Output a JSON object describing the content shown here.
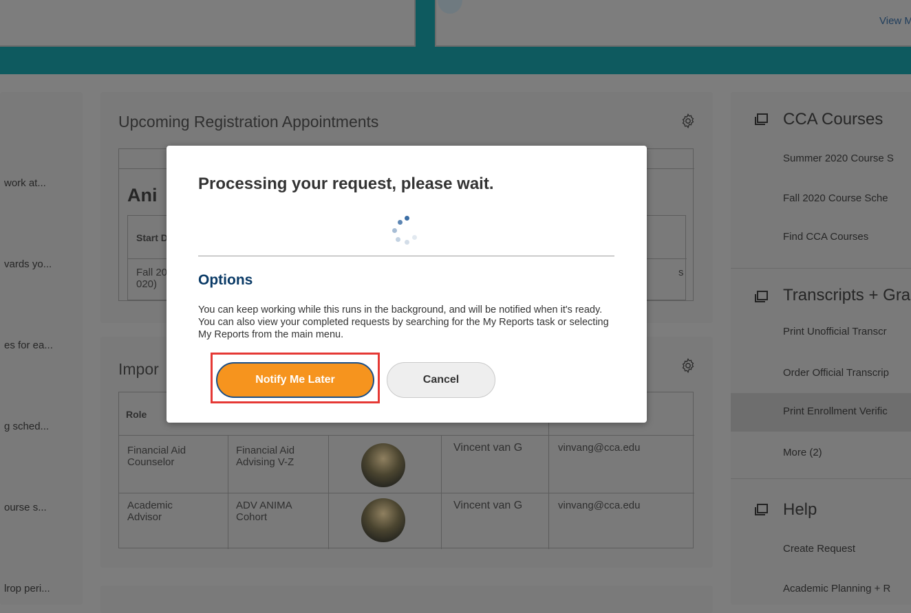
{
  "header": {
    "view_more_link": "View M"
  },
  "left_panel": {
    "items": [
      "work at...",
      "vards yo...",
      "es for ea...",
      "g sched...",
      "ourse s...",
      "lrop peri..."
    ]
  },
  "registration_card": {
    "title": "Upcoming Registration Appointments",
    "big_label": "Ani",
    "col_start": "Start D",
    "row_text": "Fall 20\n020)",
    "right_edge_text": "s"
  },
  "important_card": {
    "title": "Impor",
    "col_role": "Role",
    "rows": [
      {
        "role": "Financial Aid\nCounselor",
        "group": "Financial Aid\nAdvising V-Z",
        "name": "Vincent van G",
        "email": "vinvang@cca.edu"
      },
      {
        "role": "Academic\nAdvisor",
        "group": "ADV ANIMA\nCohort",
        "name": "Vincent van G",
        "email": "vinvang@cca.edu"
      }
    ]
  },
  "right_panel": {
    "sections": [
      {
        "title": "CCA Courses",
        "items": [
          "Summer 2020 Course S",
          "Fall 2020 Course Sche",
          "Find CCA Courses"
        ]
      },
      {
        "title": "Transcripts + Gra",
        "items": [
          "Print Unofficial Transcr",
          "Order Official Transcrip",
          "Print Enrollment Verific",
          "More (2)"
        ]
      },
      {
        "title": "Help",
        "items": [
          "Create Request",
          "Academic Planning + R"
        ]
      }
    ]
  },
  "modal": {
    "title": "Processing your request, please wait.",
    "options_title": "Options",
    "options_text": "You can keep working while this runs in the background, and will be notified when it's ready. You can also view your completed requests by searching for the My Reports task or selecting My Reports from the main menu.",
    "primary_button": "Notify Me Later",
    "secondary_button": "Cancel"
  },
  "colors": {
    "accent_orange": "#f6941e",
    "teal_band": "#0e5a5f",
    "options_blue": "#0a3a66",
    "highlight_red": "#e53935"
  }
}
